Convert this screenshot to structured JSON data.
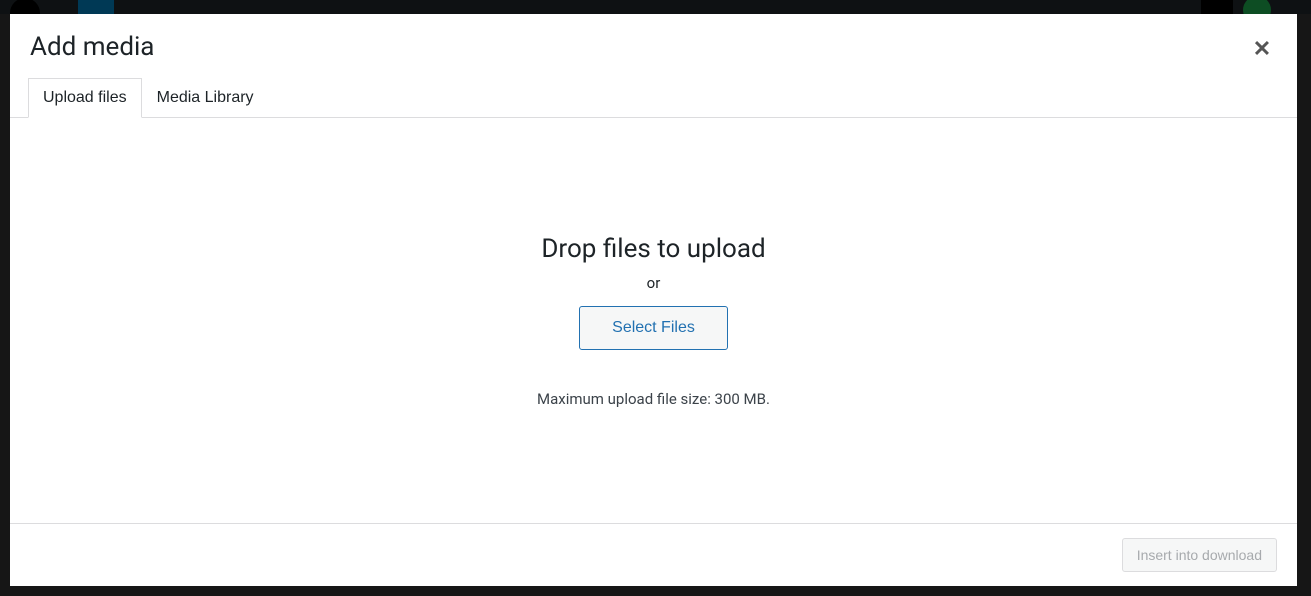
{
  "modal": {
    "title": "Add media",
    "close_label": "Close"
  },
  "tabs": {
    "upload_files": "Upload files",
    "media_library": "Media Library"
  },
  "upload": {
    "drop_text": "Drop files to upload",
    "or_text": "or",
    "select_button": "Select Files",
    "max_size_text": "Maximum upload file size: 300 MB."
  },
  "footer": {
    "insert_button": "Insert into download"
  }
}
